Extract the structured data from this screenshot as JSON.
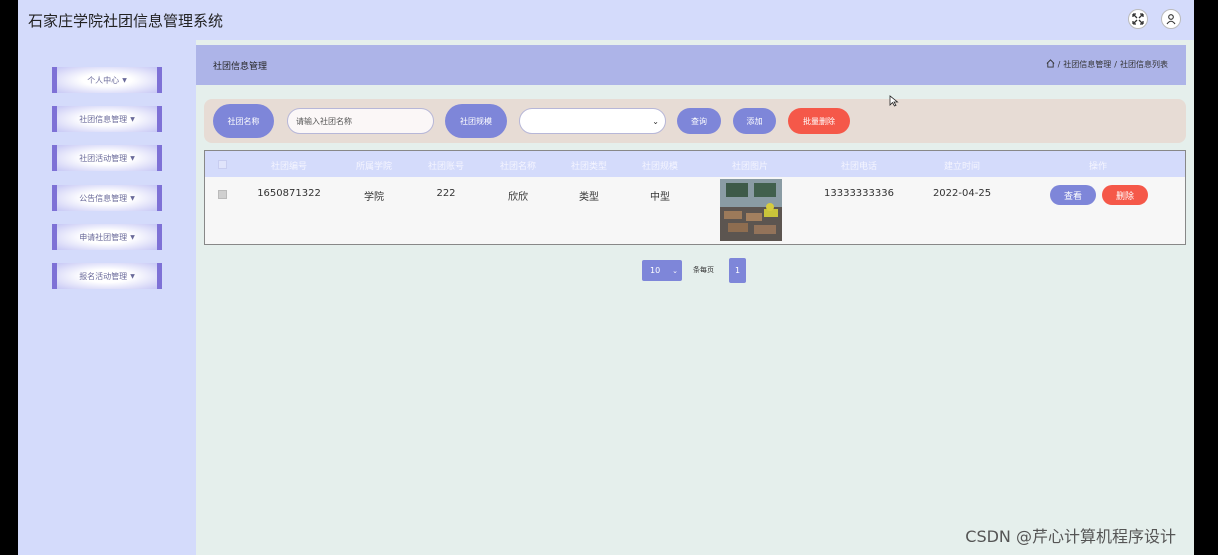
{
  "app": {
    "title": "石家庄学院社团信息管理系统"
  },
  "topbar": {
    "icons": [
      "fullscreen-icon",
      "user-icon"
    ]
  },
  "sidebar": {
    "items": [
      {
        "label": "个人中心"
      },
      {
        "label": "社团信息管理"
      },
      {
        "label": "社团活动管理"
      },
      {
        "label": "公告信息管理"
      },
      {
        "label": "申请社团管理"
      },
      {
        "label": "报名活动管理"
      }
    ]
  },
  "header": {
    "title": "社团信息管理",
    "breadcrumb": [
      "社团信息管理",
      "社团信息列表"
    ],
    "separator": "/"
  },
  "search": {
    "name_label": "社团名称",
    "name_placeholder": "请输入社团名称",
    "scale_label": "社团规模",
    "scale_value": "",
    "query_label": "查询",
    "add_label": "添加",
    "batch_delete_label": "批量删除"
  },
  "table": {
    "columns": [
      "社团编号",
      "所属学院",
      "社团账号",
      "社团名称",
      "社团类型",
      "社团规模",
      "社团图片",
      "社团电话",
      "建立时间",
      "操作"
    ],
    "rows": [
      {
        "id": "1650871322",
        "college": "学院",
        "account": "222",
        "name": "欣欣",
        "type": "类型",
        "scale": "中型",
        "phone": "13333333336",
        "date": "2022-04-25",
        "view_label": "查看",
        "delete_label": "删除"
      }
    ]
  },
  "pagination": {
    "page_size": "10",
    "per_page_label": "条每页",
    "current_page": "1"
  },
  "watermark": "CSDN @芹心计算机程序设计",
  "colors": {
    "accent": "#7e86d9",
    "danger": "#f55849",
    "sidebar": "#d4dbfb",
    "header": "#adb4e8",
    "background": "#e5efec"
  }
}
